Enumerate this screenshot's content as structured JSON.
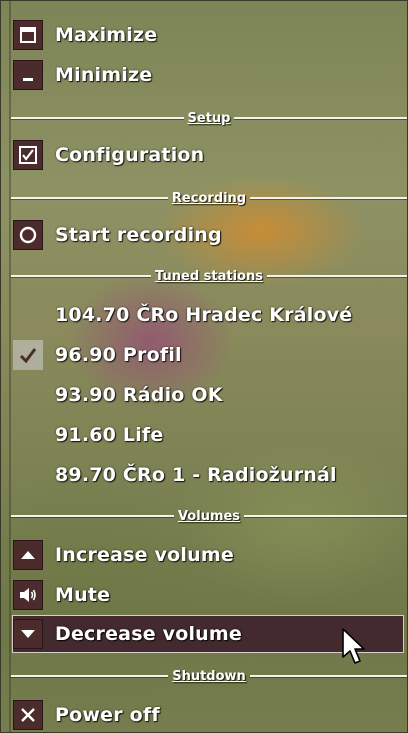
{
  "window": {
    "maximize_label": "Maximize",
    "minimize_label": "Minimize"
  },
  "setup": {
    "header": "Setup",
    "configuration_label": "Configuration"
  },
  "recording": {
    "header": "Recording",
    "start_label": "Start recording"
  },
  "stations": {
    "header": "Tuned stations",
    "items": [
      {
        "label": "104.70 ČRo Hradec Králové",
        "checked": false
      },
      {
        "label": "96.90 Profil",
        "checked": true
      },
      {
        "label": "93.90 Rádio OK",
        "checked": false
      },
      {
        "label": "91.60 Life",
        "checked": false
      },
      {
        "label": "89.70 ČRo 1 - Radiožurnál",
        "checked": false
      }
    ]
  },
  "volumes": {
    "header": "Volumes",
    "increase_label": "Increase volume",
    "mute_label": "Mute",
    "decrease_label": "Decrease volume",
    "selected_item": "Decrease volume"
  },
  "shutdown": {
    "header": "Shutdown",
    "power_off_label": "Power off"
  },
  "icons": {
    "maximize": "maximize-icon",
    "minimize": "minimize-icon",
    "configuration": "checkbox-icon",
    "start_recording": "record-circle-icon",
    "station_selected": "checkmark-icon",
    "increase_volume": "triangle-up-icon",
    "mute": "speaker-icon",
    "decrease_volume": "triangle-down-icon",
    "power_off": "close-x-icon"
  },
  "colors": {
    "selected_background": "#432a2e",
    "icon_background": "#4b2b2b",
    "text": "#ffffff"
  }
}
